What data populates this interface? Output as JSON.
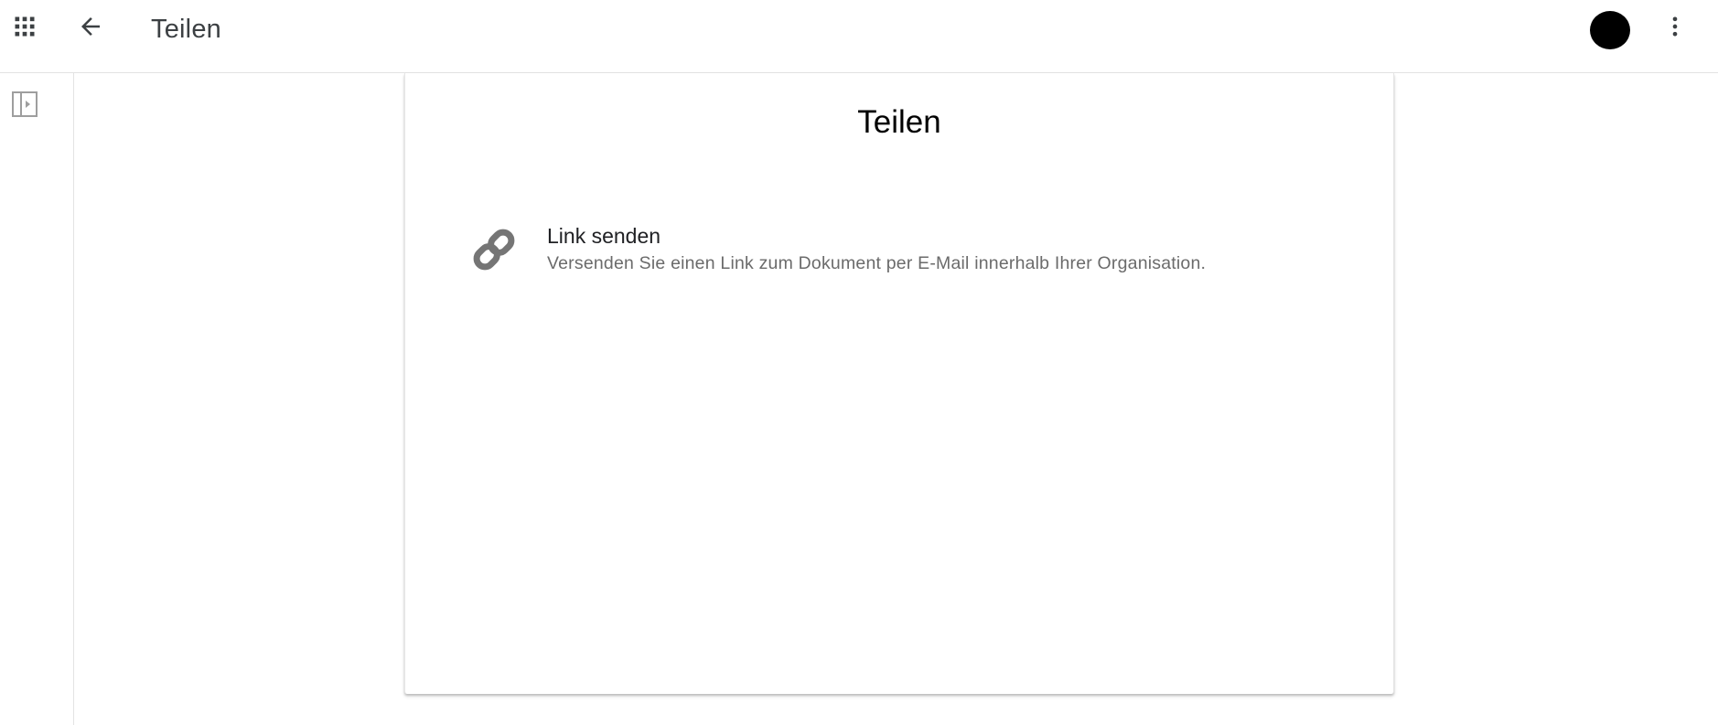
{
  "appbar": {
    "title": "Teilen",
    "apps_icon": "apps-grid-icon",
    "back_icon": "arrow-back-icon",
    "more_icon": "more-vert-icon"
  },
  "left_rail": {
    "toggle_icon": "side-panel-toggle-icon"
  },
  "card": {
    "title": "Teilen",
    "options": [
      {
        "icon": "link-icon",
        "label": "Link senden",
        "description": "Versenden Sie einen Link zum Dokument per E-Mail innerhalb Ihrer Organisation."
      }
    ]
  },
  "colors": {
    "icon_dark": "#3c4043",
    "icon_grey": "#757575",
    "rail_icon": "#9e9e9e",
    "divider": "#e3e3e3",
    "avatar": "#000000"
  }
}
